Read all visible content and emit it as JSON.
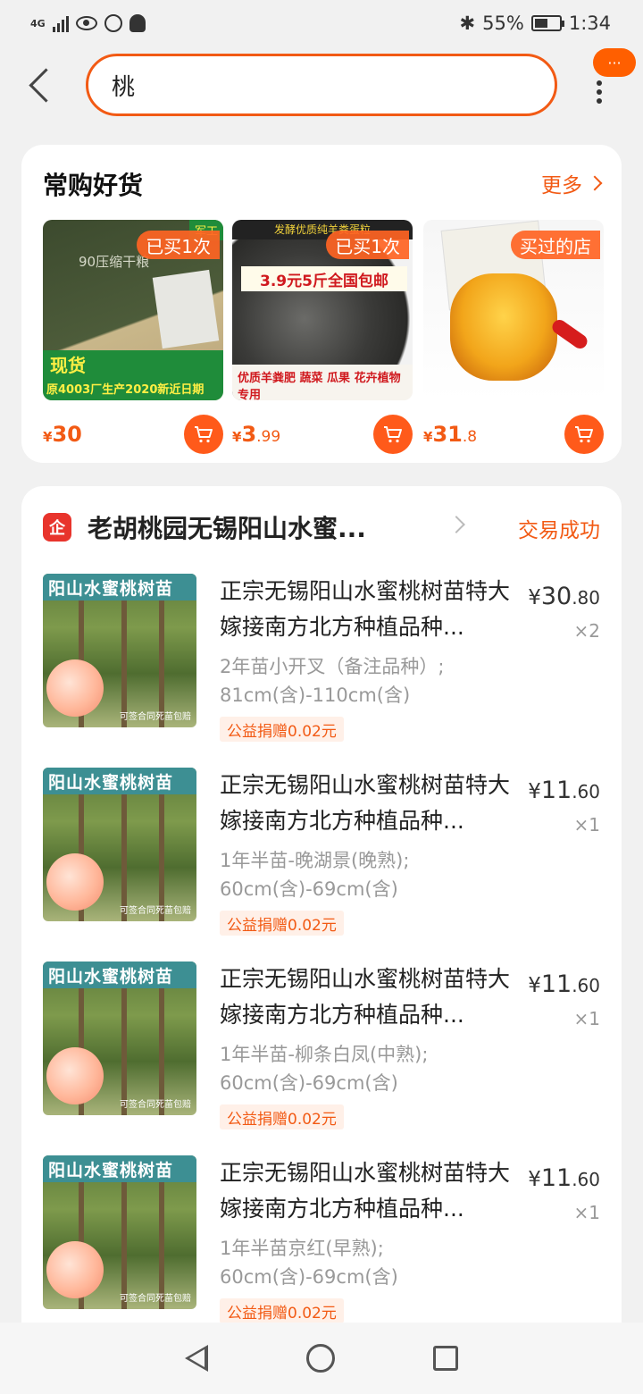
{
  "status_bar": {
    "network": "4G",
    "battery": "55%",
    "battery_level": 0.55,
    "time": "1:34"
  },
  "search": {
    "query": "桃",
    "badge": "···"
  },
  "frequent": {
    "title": "常购好货",
    "more_label": "更多",
    "products": [
      {
        "tag": "已买1次",
        "price_symbol": "¥",
        "price_int": "30",
        "price_cents": "",
        "img_text1": "现货",
        "img_text2": "原4003厂生产2020新近日期",
        "img_text_top": "90压缩干粮",
        "img_mil": "军工"
      },
      {
        "tag": "已买1次",
        "price_symbol": "¥",
        "price_int": "3",
        "price_cents": ".99",
        "img_head": "发酵优质纯羊粪蛋粒",
        "img_banner": "3.9元5斤全国包邮",
        "img_strip": "优质羊粪肥 蔬菜 瓜果 花卉植物专用"
      },
      {
        "tag": "买过的店",
        "price_symbol": "¥",
        "price_int": "31",
        "price_cents": ".8"
      }
    ]
  },
  "order": {
    "shop_name": "老胡桃园无锡阳山水蜜...",
    "shop_badge": "企",
    "status": "交易成功",
    "items": [
      {
        "title": "正宗无锡阳山水蜜桃树苗特大嫁接南方北方种植品种...",
        "price_symbol": "¥",
        "price_int": "30",
        "price_cents": ".80",
        "qty": "×2",
        "spec": "2年苗小开叉（备注品种）; 81cm(含)-110cm(含)",
        "donation": "公益捐赠0.02元",
        "img_label": "阳山水蜜桃树苗",
        "img_sub": "可签合同死苗包赔"
      },
      {
        "title": "正宗无锡阳山水蜜桃树苗特大嫁接南方北方种植品种...",
        "price_symbol": "¥",
        "price_int": "11",
        "price_cents": ".60",
        "qty": "×1",
        "spec": "1年半苗-晚湖景(晚熟); 60cm(含)-69cm(含)",
        "donation": "公益捐赠0.02元",
        "img_label": "阳山水蜜桃树苗",
        "img_sub": "可签合同死苗包赔"
      },
      {
        "title": "正宗无锡阳山水蜜桃树苗特大嫁接南方北方种植品种...",
        "price_symbol": "¥",
        "price_int": "11",
        "price_cents": ".60",
        "qty": "×1",
        "spec": "1年半苗-柳条白凤(中熟); 60cm(含)-69cm(含)",
        "donation": "公益捐赠0.02元",
        "img_label": "阳山水蜜桃树苗",
        "img_sub": "可签合同死苗包赔"
      },
      {
        "title": "正宗无锡阳山水蜜桃树苗特大嫁接南方北方种植品种...",
        "price_symbol": "¥",
        "price_int": "11",
        "price_cents": ".60",
        "qty": "×1",
        "spec": "1年半苗京红(早熟); 60cm(含)-69cm(含)",
        "donation": "公益捐赠0.02元",
        "img_label": "阳山水蜜桃树苗",
        "img_sub": "可签合同死苗包赔"
      }
    ]
  },
  "colors": {
    "accent": "#f25a14",
    "tag_bg": "#ff6423",
    "teal_label": "#3d8f93"
  },
  "icons": [
    "back-arrow-icon",
    "kebab-menu-icon",
    "chevron-right-icon",
    "cart-icon",
    "shop-enterprise-icon",
    "nav-back-icon",
    "nav-home-icon",
    "nav-recent-icon"
  ]
}
